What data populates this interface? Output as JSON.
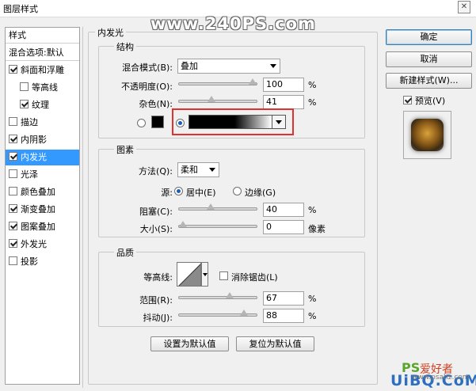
{
  "window": {
    "title": "图层样式",
    "close_glyph": "✕"
  },
  "watermark_top": "www.240PS.com",
  "styles_list": {
    "header": "样式",
    "blend_default": "混合选项:默认",
    "items": [
      {
        "label": "斜面和浮雕",
        "checked": true
      },
      {
        "label": "等高线",
        "checked": false
      },
      {
        "label": "纹理",
        "checked": true
      },
      {
        "label": "描边",
        "checked": false
      },
      {
        "label": "内阴影",
        "checked": true
      },
      {
        "label": "内发光",
        "checked": true
      },
      {
        "label": "光泽",
        "checked": false
      },
      {
        "label": "颜色叠加",
        "checked": false
      },
      {
        "label": "渐变叠加",
        "checked": true
      },
      {
        "label": "图案叠加",
        "checked": true
      },
      {
        "label": "外发光",
        "checked": true
      },
      {
        "label": "投影",
        "checked": false
      }
    ],
    "selected": "内发光"
  },
  "inner_glow": {
    "title": "内发光",
    "structure": {
      "title": "结构",
      "blend_mode_label": "混合模式(B):",
      "blend_mode_value": "叠加",
      "opacity_label": "不透明度(O):",
      "opacity_value": "100",
      "opacity_unit": "%",
      "opacity_fraction": 1.0,
      "noise_label": "杂色(N):",
      "noise_value": "41",
      "noise_unit": "%",
      "noise_fraction": 0.41,
      "color_swatch": "#000000",
      "gradient": [
        "#000000",
        "#ffffff"
      ],
      "selected_fill": "gradient"
    },
    "elements": {
      "title": "图素",
      "technique_label": "方法(Q):",
      "technique_value": "柔和",
      "source_label": "源:",
      "source_center": "居中(E)",
      "source_edge": "边缘(G)",
      "source_selected": "center",
      "choke_label": "阻塞(C):",
      "choke_value": "40",
      "choke_unit": "%",
      "choke_fraction": 0.4,
      "size_label": "大小(S):",
      "size_value": "0",
      "size_unit": "像素",
      "size_fraction": 0.0
    },
    "quality": {
      "title": "品质",
      "contour_label": "等高线:",
      "antialias_label": "消除锯齿(L)",
      "antialias_checked": false,
      "range_label": "范围(R):",
      "range_value": "67",
      "range_unit": "%",
      "range_fraction": 0.67,
      "jitter_label": "抖动(J):",
      "jitter_value": "88",
      "jitter_unit": "%",
      "jitter_fraction": 0.88
    },
    "make_default": "设置为默认值",
    "reset_default": "复位为默认值"
  },
  "buttons": {
    "ok": "确定",
    "cancel": "取消",
    "new_style": "新建样式(W)..."
  },
  "preview": {
    "label": "预览(V)",
    "checked": true
  },
  "watermark_bottom": {
    "ps": "PS",
    "cn": "爱好者",
    "site": "UiBQ.CoM",
    "small": "www.psahz.com"
  },
  "colors": {
    "selection": "#3399ff",
    "highlight_box": "#e03030",
    "ok_border": "#3c7fb1"
  }
}
